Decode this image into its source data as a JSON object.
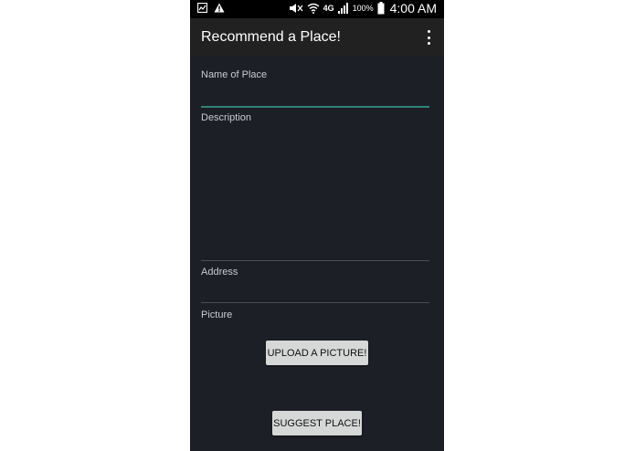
{
  "status_bar": {
    "battery_percent": "100%",
    "time": "4:00 AM",
    "network": "4G",
    "left_icons": [
      "screenshot-icon",
      "warning-icon"
    ],
    "right_icons": [
      "mute-icon",
      "wifi-icon",
      "signal-icon",
      "battery-icon"
    ]
  },
  "app_bar": {
    "title": "Recommend a Place!",
    "overflow_icon": "more-vert-icon"
  },
  "form": {
    "name_label": "Name of Place",
    "name_value": "",
    "description_label": "Description",
    "description_value": "",
    "address_label": "Address",
    "address_value": "",
    "picture_label": "Picture",
    "upload_button": "UPLOAD A PICTURE!",
    "submit_button": "SUGGEST PLACE!"
  },
  "colors": {
    "background": "#1d1f27",
    "app_bar": "#212121",
    "accent": "#2f8377",
    "button": "#d6d7d7"
  }
}
